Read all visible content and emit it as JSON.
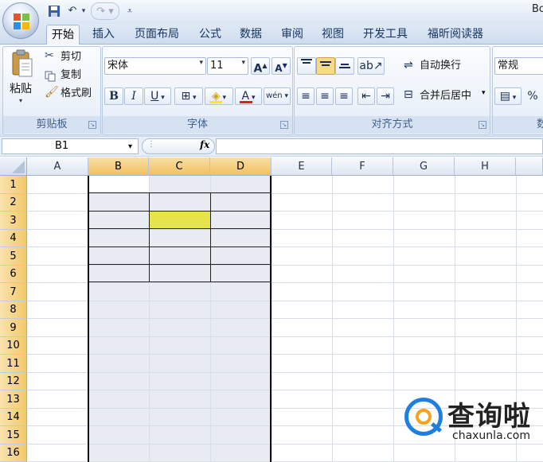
{
  "window": {
    "title_fragment": "Bo"
  },
  "quick_access": {
    "save_icon": "save-icon",
    "undo_icon": "undo-icon",
    "redo_icon": "redo-icon",
    "customize": "customize-qat-icon"
  },
  "tabs": [
    "开始",
    "插入",
    "页面布局",
    "公式",
    "数据",
    "审阅",
    "视图",
    "开发工具",
    "福昕阅读器"
  ],
  "active_tab": "开始",
  "clipboard": {
    "paste": "粘贴",
    "cut": "剪切",
    "copy": "复制",
    "format_painter": "格式刷",
    "label": "剪贴板"
  },
  "font": {
    "name": "宋体",
    "size": "11",
    "bold": "B",
    "italic": "I",
    "underline": "U",
    "grow": "A",
    "shrink": "A",
    "color_letter": "A",
    "phonetic": "wén",
    "label": "字体"
  },
  "alignment": {
    "wrap": "自动换行",
    "merge": "合并后居中",
    "label": "对齐方式"
  },
  "number": {
    "format": "常规",
    "percent": "%",
    "label": "数"
  },
  "formula_bar": {
    "name_box": "B1",
    "fx": "fx",
    "formula": ""
  },
  "columns": [
    "A",
    "B",
    "C",
    "D",
    "E",
    "F",
    "G",
    "H"
  ],
  "rows": [
    "1",
    "2",
    "3",
    "4",
    "5",
    "6",
    "7",
    "8",
    "9",
    "10",
    "11",
    "12",
    "13",
    "14",
    "15",
    "16"
  ],
  "watermark": {
    "text": "查询啦",
    "url": "chaxunla.com"
  },
  "colors": {
    "accent": "#1f7fe0",
    "yellow_cell": "#e7e34a",
    "selected_header": "#f1c15f"
  }
}
